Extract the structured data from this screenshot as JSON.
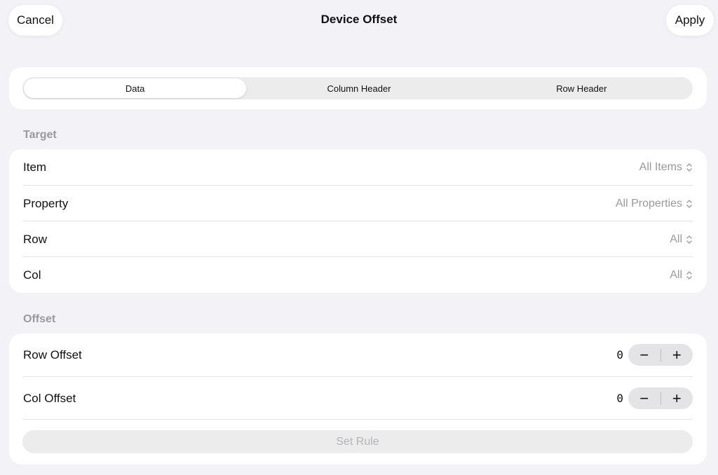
{
  "header": {
    "title": "Device Offset",
    "cancel_label": "Cancel",
    "apply_label": "Apply"
  },
  "segments": [
    {
      "label": "Data",
      "selected": true
    },
    {
      "label": "Column Header",
      "selected": false
    },
    {
      "label": "Row Header",
      "selected": false
    }
  ],
  "target": {
    "header": "Target",
    "rows": [
      {
        "label": "Item",
        "value": "All Items"
      },
      {
        "label": "Property",
        "value": "All Properties"
      },
      {
        "label": "Row",
        "value": "All"
      },
      {
        "label": "Col",
        "value": "All"
      }
    ]
  },
  "offset": {
    "header": "Offset",
    "row_offset": {
      "label": "Row Offset",
      "value": "0",
      "minus": "−",
      "plus": "+"
    },
    "col_offset": {
      "label": "Col Offset",
      "value": "0",
      "minus": "−",
      "plus": "+"
    },
    "set_rule_label": "Set Rule"
  },
  "icons": {
    "picker": "chevron-up-down-icon"
  },
  "colors": {
    "background": "#f2f2f7",
    "card": "#ffffff",
    "secondary_text": "#9a9a9e",
    "disabled_text": "#b4b4b8"
  }
}
